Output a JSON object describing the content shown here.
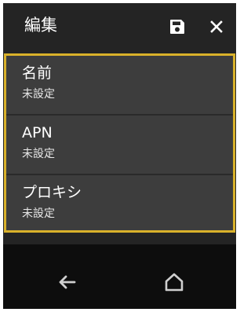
{
  "header": {
    "title": "編集",
    "save_icon": "save-icon",
    "close_icon": "close-icon"
  },
  "list": {
    "items": [
      {
        "title": "名前",
        "value": "未設定"
      },
      {
        "title": "APN",
        "value": "未設定"
      },
      {
        "title": "プロキシ",
        "value": "未設定"
      }
    ]
  },
  "navbar": {
    "back_icon": "back-arrow-icon",
    "home_icon": "home-icon"
  },
  "colors": {
    "background": "#242424",
    "list_background": "#3d3d3d",
    "focus_border": "#d9b12a",
    "navbar": "#0d0d0d",
    "text": "#ffffff"
  }
}
